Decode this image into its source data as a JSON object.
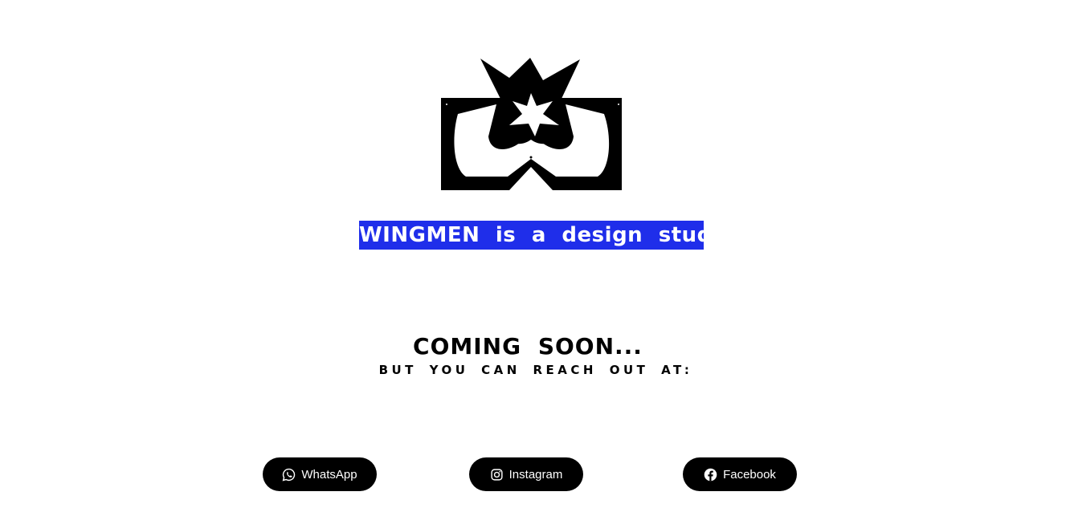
{
  "brand": {
    "tagline": "WINGMEN is a design studio",
    "accent_color": "#1f2eea"
  },
  "hero": {
    "heading": "COMING SOON...",
    "subheading": "BUT YOU CAN REACH OUT AT:"
  },
  "social": {
    "buttons": [
      {
        "label": "WhatsApp",
        "icon": "whatsapp-icon"
      },
      {
        "label": "Instagram",
        "icon": "instagram-icon"
      },
      {
        "label": "Facebook",
        "icon": "facebook-icon"
      }
    ]
  }
}
